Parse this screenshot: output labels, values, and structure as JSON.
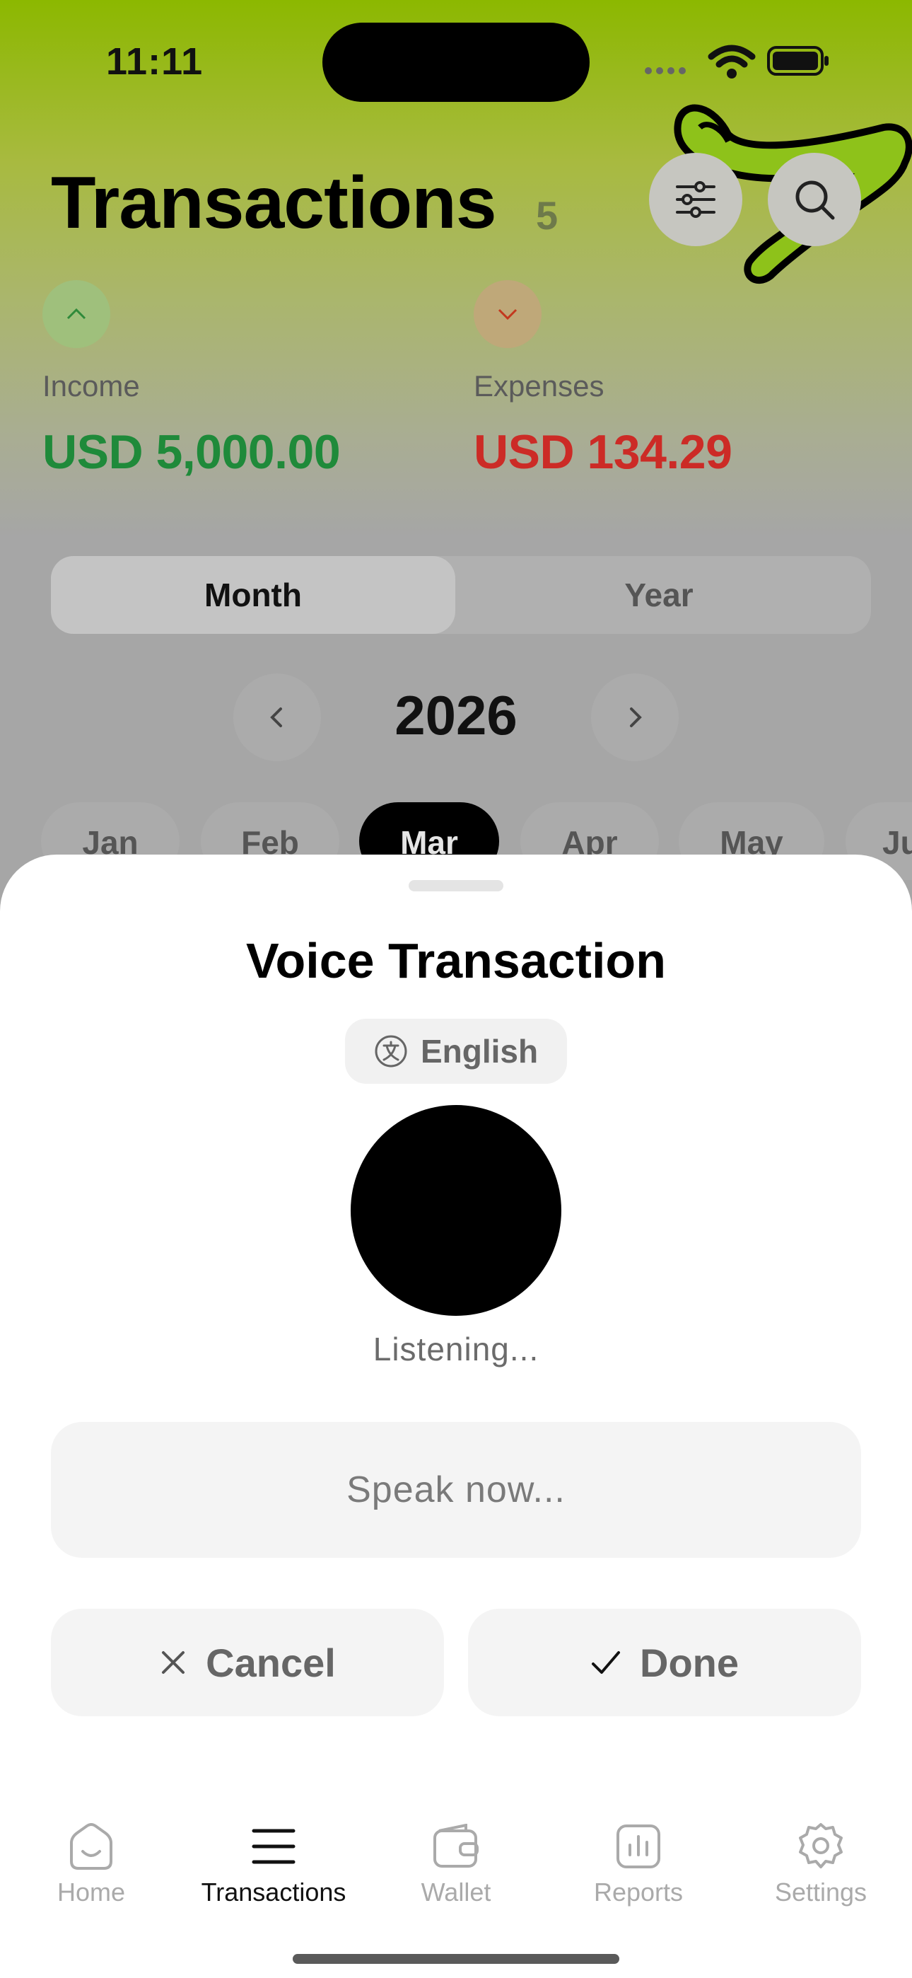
{
  "status_bar": {
    "time": "11:11"
  },
  "header": {
    "title": "Transactions",
    "count": "5"
  },
  "summary": {
    "income": {
      "label": "Income",
      "amount": "USD 5,000.00",
      "color": "#1f8a3a"
    },
    "expenses": {
      "label": "Expenses",
      "amount": "USD 134.29",
      "color": "#cc2b26"
    }
  },
  "period": {
    "segments": [
      "Month",
      "Year"
    ],
    "selected": "Month",
    "year": "2026",
    "months": [
      "Jan",
      "Feb",
      "Mar",
      "Apr",
      "May",
      "Ju"
    ],
    "selected_month": "Mar"
  },
  "voice_sheet": {
    "title": "Voice Transaction",
    "language": "English",
    "status": "Listening...",
    "transcript_placeholder": "Speak now...",
    "cancel_label": "Cancel",
    "done_label": "Done"
  },
  "tab_bar": {
    "tabs": [
      {
        "label": "Home",
        "icon": "home-icon"
      },
      {
        "label": "Transactions",
        "icon": "list-icon"
      },
      {
        "label": "Wallet",
        "icon": "wallet-icon"
      },
      {
        "label": "Reports",
        "icon": "chart-icon"
      },
      {
        "label": "Settings",
        "icon": "gear-icon"
      }
    ],
    "active": "Transactions"
  },
  "colors": {
    "accent_green": "#8cb800",
    "income_green": "#1f8a3a",
    "expense_red": "#cc2b26"
  }
}
